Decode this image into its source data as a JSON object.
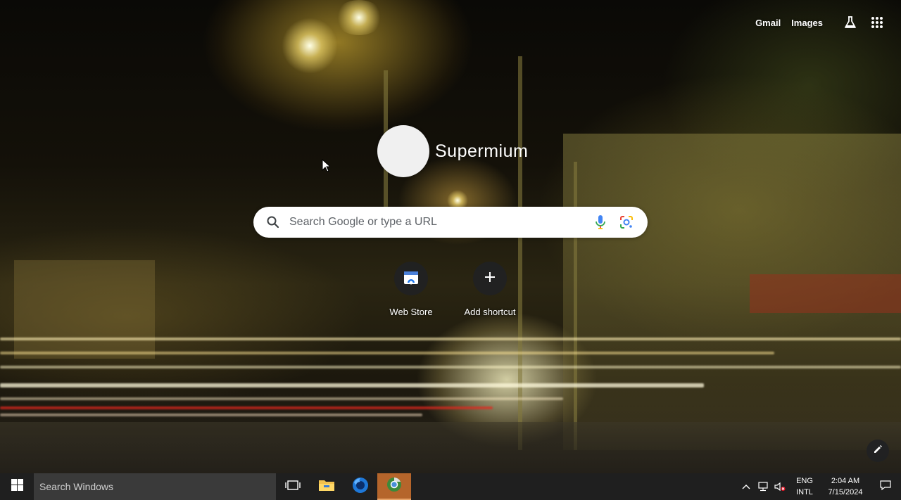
{
  "header": {
    "links": [
      {
        "label": "Gmail"
      },
      {
        "label": "Images"
      }
    ],
    "labs_icon": "flask-icon",
    "apps_icon": "apps-grid-icon"
  },
  "logo": {
    "text": "Supermium"
  },
  "search": {
    "placeholder": "Search Google or type a URL",
    "search_icon": "search-icon",
    "voice_icon": "microphone-icon",
    "lens_icon": "lens-icon"
  },
  "shortcuts": [
    {
      "label": "Web Store",
      "icon": "web-store-icon"
    },
    {
      "label": "Add shortcut",
      "icon": "plus-icon"
    }
  ],
  "customize": {
    "icon": "pencil-icon"
  },
  "taskbar": {
    "search_placeholder": "Search Windows",
    "apps": [
      {
        "name": "task-view",
        "icon": "task-view-icon"
      },
      {
        "name": "file-explorer",
        "icon": "folder-icon"
      },
      {
        "name": "firefox",
        "icon": "firefox-icon"
      },
      {
        "name": "supermium",
        "icon": "supermium-icon",
        "active": true
      }
    ],
    "tray": {
      "language_line1": "ENG",
      "language_line2": "INTL",
      "time": "2:04 AM",
      "date": "7/15/2024"
    }
  },
  "colors": {
    "search_bg": "#ffffff",
    "taskbar_bg": "#1f1f1f",
    "active_app": "#b5652b",
    "shortcut_tile": "#202124"
  }
}
